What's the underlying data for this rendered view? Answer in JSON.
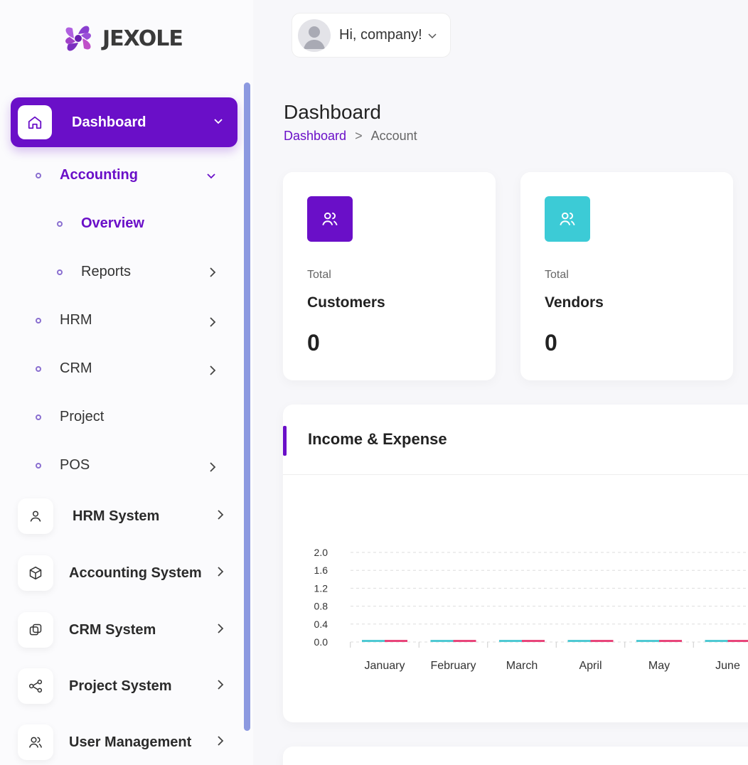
{
  "brand": {
    "name": "JEXOLE"
  },
  "header": {
    "greeting": "Hi, company!"
  },
  "sidebar": {
    "active": {
      "label": "Dashboard"
    },
    "accounting": {
      "label": "Accounting"
    },
    "overview": {
      "label": "Overview"
    },
    "reports": {
      "label": "Reports"
    },
    "hrm": {
      "label": "HRM"
    },
    "crm": {
      "label": "CRM"
    },
    "project": {
      "label": "Project"
    },
    "pos": {
      "label": "POS"
    },
    "systems": [
      {
        "label": "HRM System",
        "icon": "user-icon"
      },
      {
        "label": "Accounting System",
        "icon": "box-icon"
      },
      {
        "label": "CRM System",
        "icon": "layers-icon"
      },
      {
        "label": "Project System",
        "icon": "share-icon"
      },
      {
        "label": "User Management",
        "icon": "users-icon"
      }
    ]
  },
  "page": {
    "title": "Dashboard",
    "breadcrumb": {
      "link": "Dashboard",
      "separator": ">",
      "current": "Account"
    }
  },
  "stats": [
    {
      "small": "Total",
      "name": "Customers",
      "value": "0",
      "color": "#6a0fc8"
    },
    {
      "small": "Total",
      "name": "Vendors",
      "value": "0",
      "color": "#3ccbd6"
    }
  ],
  "chart_data": {
    "type": "bar",
    "title": "Income & Expense",
    "categories": [
      "January",
      "February",
      "March",
      "April",
      "May",
      "June"
    ],
    "series": [
      {
        "values": [
          0,
          0,
          0,
          0,
          0,
          0
        ],
        "color": "#4fc9d3"
      },
      {
        "values": [
          0,
          0,
          0,
          0,
          0,
          0
        ],
        "color": "#e8457a"
      }
    ],
    "ylim": [
      0,
      2.0
    ],
    "yticks": [
      "0.0",
      "0.4",
      "0.8",
      "1.2",
      "1.6",
      "2.0"
    ],
    "grid": true
  },
  "colors": {
    "accent": "#6a0fc8",
    "teal": "#3ccbd6"
  }
}
